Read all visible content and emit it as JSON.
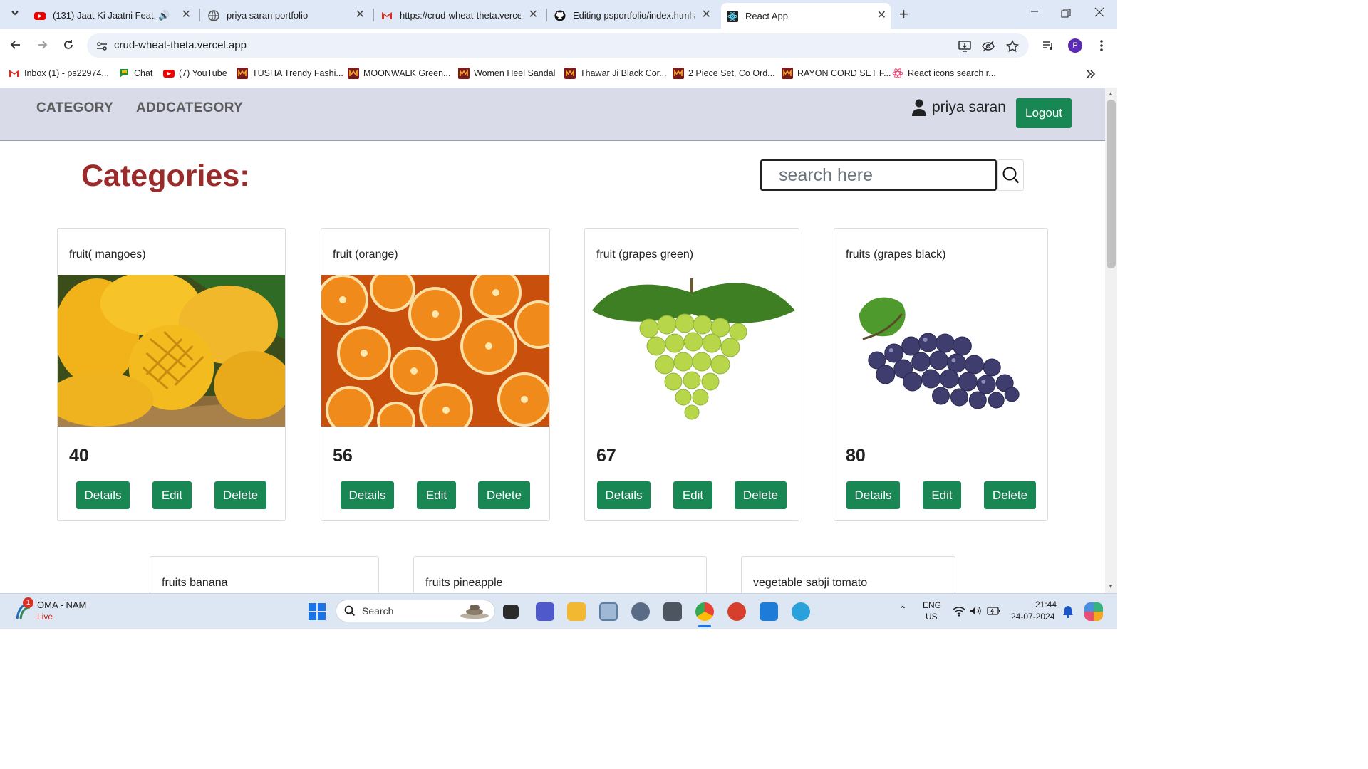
{
  "browser": {
    "tabs": [
      {
        "title": "(131) Jaat Ki Jaatni Feat. Pa",
        "icon": "youtube-icon"
      },
      {
        "title": "priya saran portfolio",
        "icon": "globe-icon"
      },
      {
        "title": "https://crud-wheat-theta.vercel.",
        "icon": "gmail-icon"
      },
      {
        "title": "Editing psportfolio/index.html a",
        "icon": "github-icon"
      },
      {
        "title": "React App",
        "icon": "react-icon"
      }
    ],
    "url": "crud-wheat-theta.vercel.app",
    "bookmarks": [
      "Inbox (1) - ps22974...",
      "Chat",
      "(7) YouTube",
      "TUSHA Trendy Fashi...",
      "MOONWALK Green...",
      "Women Heel Sandal",
      "Thawar Ji Black Cor...",
      "2 Piece Set, Co Ord...",
      "RAYON CORD SET F...",
      "React icons search r..."
    ],
    "profile_initial": "P"
  },
  "app": {
    "nav": {
      "category": "CATEGORY",
      "addcategory": "ADDCATEGORY",
      "username": "priya saran",
      "logout": "Logout"
    },
    "heading": "Categories:",
    "search_placeholder": "search here",
    "buttons": {
      "details": "Details",
      "edit": "Edit",
      "delete": "Delete"
    },
    "cards": [
      {
        "name": "fruit( mangoes)",
        "price": "40"
      },
      {
        "name": "fruit (orange)",
        "price": "56"
      },
      {
        "name": "fruit (grapes green)",
        "price": "67"
      },
      {
        "name": "fruits (grapes black)",
        "price": "80"
      }
    ],
    "cards_row2": [
      {
        "name": "fruits banana"
      },
      {
        "name": "fruits pineapple"
      },
      {
        "name": "vegetable sabji tomato"
      }
    ]
  },
  "taskbar": {
    "weather_badge": "1",
    "weather_title": "OMA - NAM",
    "weather_sub": "Live",
    "search_label": "Search",
    "lang_top": "ENG",
    "lang_bottom": "US",
    "time": "21:44",
    "date": "24-07-2024"
  },
  "colors": {
    "accent_green": "#198754",
    "heading_red": "#9b2a2a",
    "nav_bg": "#d9dbe9"
  }
}
